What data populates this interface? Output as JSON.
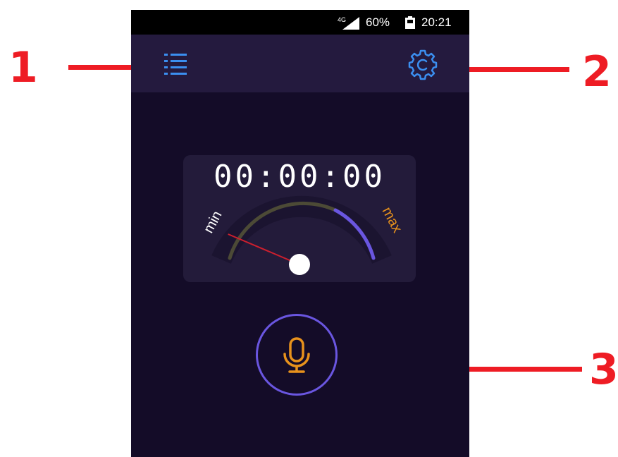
{
  "callouts": [
    "1",
    "2",
    "3"
  ],
  "status_bar": {
    "network": "4G",
    "battery_percent": "60%",
    "time": "20:21"
  },
  "app_bar": {
    "menu_icon": "list-icon",
    "settings_icon": "gear-icon"
  },
  "timer": "00:00:00",
  "gauge": {
    "min_label": "min",
    "max_label": "max",
    "level": 0.0,
    "colors": {
      "track": "#1b1430",
      "low_arc": "#4c4a36",
      "high_arc": "#6a56e0",
      "needle": "#cc1f2e",
      "min_text": "#ffffff",
      "max_text": "#e8921c"
    }
  },
  "record_button": {
    "icon": "microphone-icon",
    "ring_color": "#6a56e0",
    "icon_color": "#e8921c"
  },
  "colors": {
    "background": "#140c28",
    "app_bar": "#241a3e",
    "accent_blue": "#3b8ff0",
    "callout_red": "#ee1c24"
  }
}
